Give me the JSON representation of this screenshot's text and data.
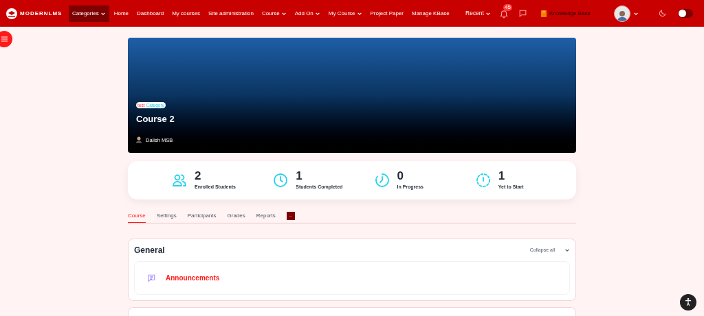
{
  "brand": "MODERNLMS",
  "nav": [
    {
      "label": "Categories",
      "dropdown": true,
      "selected": true
    },
    {
      "label": "Home",
      "dropdown": false,
      "selected": false
    },
    {
      "label": "Dashboard",
      "dropdown": false,
      "selected": false
    },
    {
      "label": "My courses",
      "dropdown": false,
      "selected": false
    },
    {
      "label": "Site administration",
      "dropdown": false,
      "selected": false
    },
    {
      "label": "Course",
      "dropdown": true,
      "selected": false
    },
    {
      "label": "Add On",
      "dropdown": true,
      "selected": false
    },
    {
      "label": "My Course",
      "dropdown": true,
      "selected": false
    },
    {
      "label": "Project Paper",
      "dropdown": false,
      "selected": false
    },
    {
      "label": "Manage KBase",
      "dropdown": false,
      "selected": false
    }
  ],
  "header_right": {
    "recent": "Recent",
    "notification_count": "45",
    "knowledge_base": "Knowledge Base",
    "dark_mode": false
  },
  "hero": {
    "tag": "test",
    "category": "Category",
    "title": "Course 2",
    "teacher": "Dalish MSB"
  },
  "stats": [
    {
      "kind": "users",
      "value": "2",
      "label": "Enrolled Students"
    },
    {
      "kind": "clock",
      "value": "1",
      "label": "Students Completed"
    },
    {
      "kind": "progress",
      "value": "0",
      "label": "In Progress"
    },
    {
      "kind": "pending",
      "value": "1",
      "label": "Yet to Start"
    }
  ],
  "tabs": [
    {
      "label": "Course",
      "selected": true
    },
    {
      "label": "Settings",
      "selected": false
    },
    {
      "label": "Participants",
      "selected": false
    },
    {
      "label": "Grades",
      "selected": false
    },
    {
      "label": "Reports",
      "selected": false
    }
  ],
  "more_button": "···",
  "section": {
    "title": "General",
    "collapse": "Collapse all",
    "activities": [
      {
        "name": "Announcements"
      }
    ]
  }
}
